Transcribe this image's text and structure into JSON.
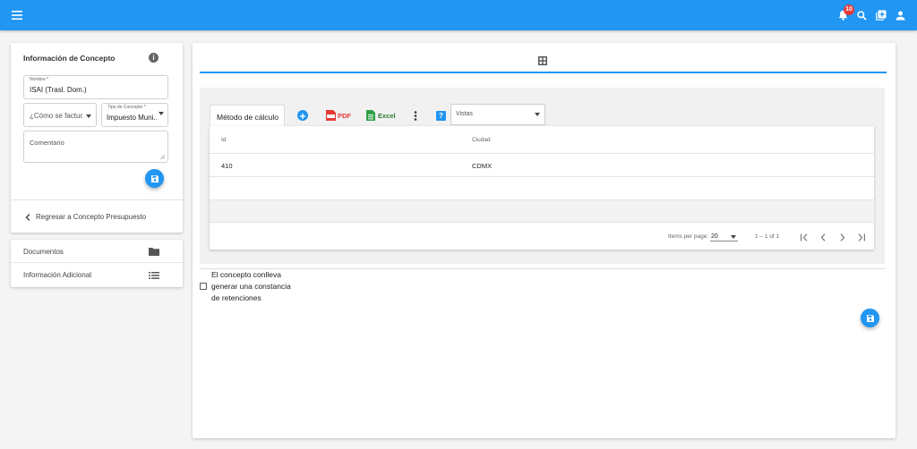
{
  "topbar": {
    "notification_count": "10",
    "colors": {
      "primary": "#2196f3",
      "badge": "#e53935"
    }
  },
  "concept_panel": {
    "title": "Información de Concepto",
    "nombre": {
      "label": "Nombre *",
      "value": "ISAI (Trasl. Dom.)"
    },
    "facturacion": {
      "placeholder": "¿Cómo se factur..."
    },
    "tipo_concepto": {
      "label": "Tipo de Concepto *",
      "value": "Impuesto Muni..."
    },
    "comentario": {
      "placeholder": "Comentario"
    },
    "back_link": "Regresar a Concepto Presupuesto"
  },
  "side_menu": {
    "items": [
      {
        "label": "Documentos",
        "icon": "folder-icon"
      },
      {
        "label": "Información Adicional",
        "icon": "list-icon"
      }
    ]
  },
  "toolbar": {
    "tab_label": "Método de cálculo",
    "pdf_label": "PDF",
    "excel_label": "Excel",
    "help_label": "?",
    "vistas_placeholder": "Vistas"
  },
  "table": {
    "columns": [
      "Id",
      "Ciudad"
    ],
    "rows": [
      {
        "id": "410",
        "ciudad": "CDMX"
      }
    ]
  },
  "paginator": {
    "items_per_page_label": "Items per page:",
    "page_size": "20",
    "range_label": "1 – 1 of 1"
  },
  "retention_checkbox": {
    "label_line1": "El concepto conlleva",
    "label_line2": "generar una constancia",
    "label_line3": "de retenciones",
    "checked": false
  }
}
